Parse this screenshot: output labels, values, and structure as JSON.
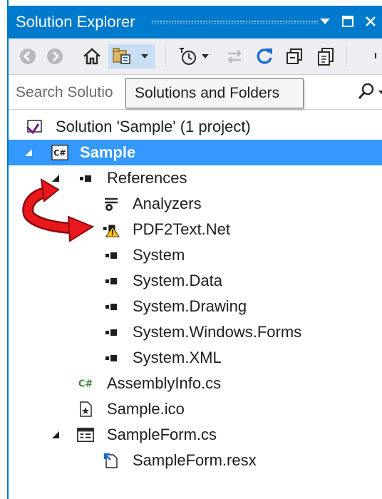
{
  "window": {
    "title": "Solution Explorer"
  },
  "colors": {
    "accent": "#007acc",
    "selection": "#3399ff",
    "toolbar_bg": "#eeeef2",
    "csharp_green": "#388a34",
    "arrow_red": "#e8181c",
    "warning_yellow": "#f7c00a"
  },
  "titlebar_icons": [
    "dropdown-triangle-icon",
    "maximize-icon",
    "close-icon"
  ],
  "toolbar": {
    "icons": [
      "back-icon",
      "forward-icon",
      "home-icon",
      "solutions-folders-icon",
      "dropdown-icon",
      "pending-changes-icon",
      "sync-icon",
      "refresh-icon",
      "collapse-all-icon",
      "show-all-files-icon"
    ]
  },
  "search": {
    "placeholder": "Search Solutio"
  },
  "tooltip": {
    "text": "Solutions and Folders"
  },
  "tree": {
    "solution": "Solution 'Sample' (1 project)",
    "project": "Sample",
    "references": "References",
    "reference_items": [
      "Analyzers",
      "PDF2Text.Net",
      "System",
      "System.Data",
      "System.Drawing",
      "System.Windows.Forms",
      "System.XML"
    ],
    "files": {
      "assembly_info": "AssemblyInfo.cs",
      "icon_file": "Sample.ico",
      "form": "SampleForm.cs",
      "form_resx": "SampleForm.resx"
    }
  }
}
